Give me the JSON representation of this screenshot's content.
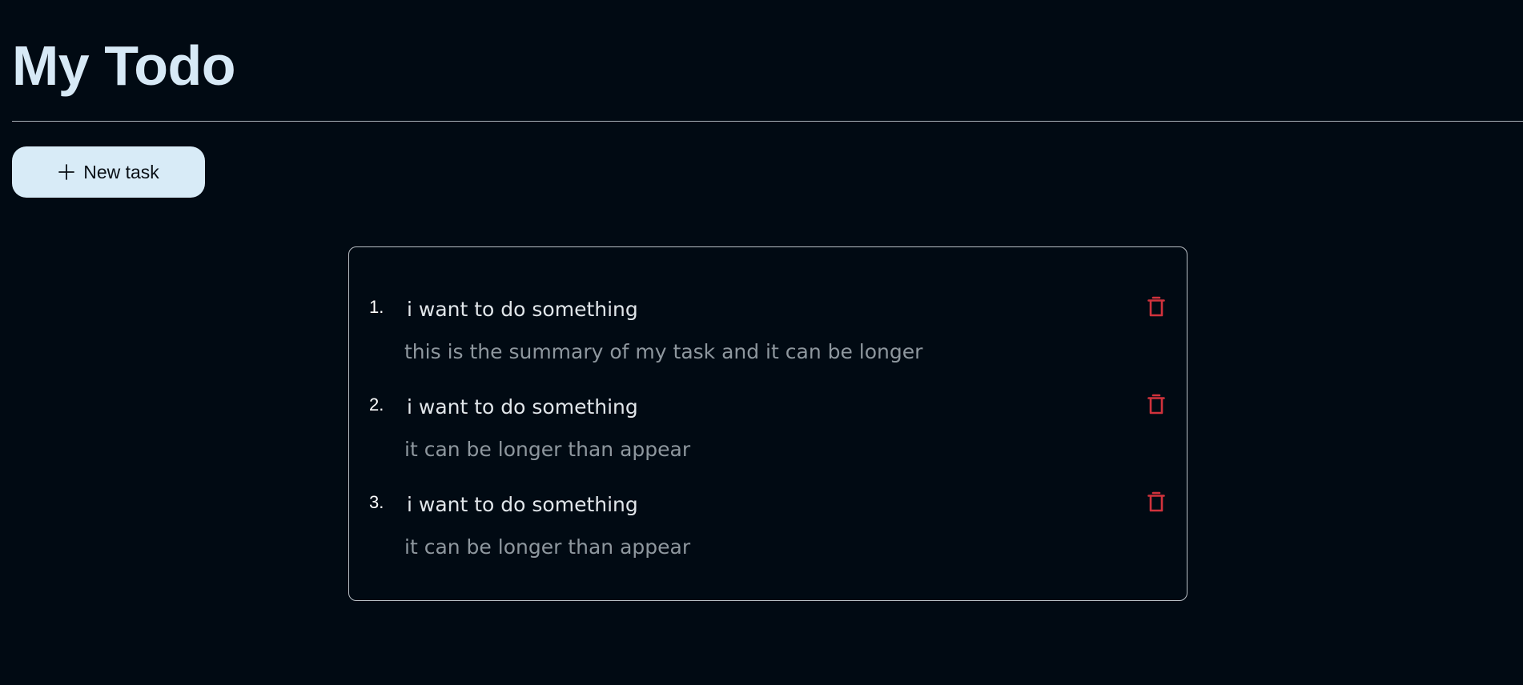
{
  "header": {
    "title": "My Todo"
  },
  "toolbar": {
    "new_task_label": "New task",
    "new_task_icon": "plus-icon"
  },
  "colors": {
    "background": "#010a13",
    "title": "#d7e9f6",
    "button_bg": "#d8ebf7",
    "delete_icon": "#d1323c"
  },
  "tasks": [
    {
      "number": "1.",
      "title": "i want to do something",
      "summary": "this is the summary of my task and it can be longer",
      "delete_icon": "trash-icon"
    },
    {
      "number": "2.",
      "title": "i want to do something",
      "summary": "it can be longer than appear",
      "delete_icon": "trash-icon"
    },
    {
      "number": "3.",
      "title": "i want to do something",
      "summary": "it can be longer than appear",
      "delete_icon": "trash-icon"
    }
  ]
}
